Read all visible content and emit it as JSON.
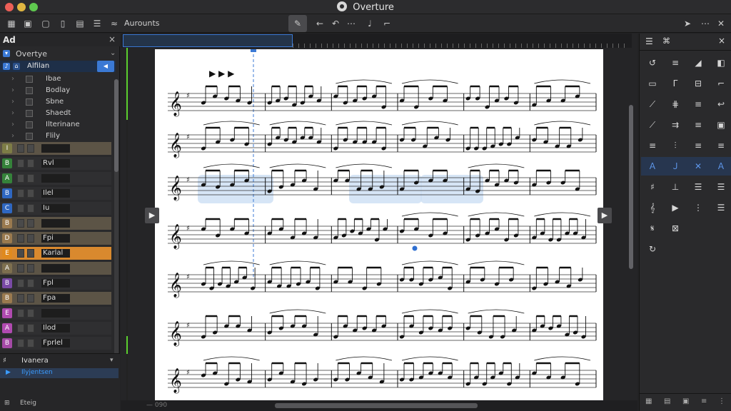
{
  "window": {
    "title": "Overture"
  },
  "toolbar": {
    "label": "Aurounts"
  },
  "left_panel": {
    "header": "Ad",
    "close_symbol": "×",
    "tree_root": "Overtye",
    "selected_item": "Alfilan",
    "tree_items": [
      "Ibae",
      "Bodlay",
      "Sbne",
      "Shaedt",
      "Ilterinane",
      "Flily"
    ],
    "tracks": [
      {
        "badge": "I",
        "color": "#7d7c46",
        "name": "",
        "extra": ""
      },
      {
        "badge": "B",
        "color": "#35823a",
        "name": "Rvl",
        "extra": ""
      },
      {
        "badge": "A",
        "color": "#35823a",
        "name": "",
        "extra": ""
      },
      {
        "badge": "B",
        "color": "#2f67c1",
        "name": "Ilel",
        "extra": ""
      },
      {
        "badge": "C",
        "color": "#2f67c1",
        "name": "Iu",
        "extra": ""
      },
      {
        "badge": "B",
        "color": "#9a7a4f",
        "name": "",
        "extra": ""
      },
      {
        "badge": "D",
        "color": "#9a7a4f",
        "name": "Fpi",
        "extra": ""
      },
      {
        "badge": "E",
        "color": "#e08a1e",
        "name": "Karlal",
        "extra": ""
      },
      {
        "badge": "A",
        "color": "#7d6f4f",
        "name": "",
        "extra": ""
      },
      {
        "badge": "B",
        "color": "#7a4aa6",
        "name": "Fpl",
        "extra": ""
      },
      {
        "badge": "B",
        "color": "#9a7a4f",
        "name": "Fpa",
        "extra": ""
      },
      {
        "badge": "E",
        "color": "#b04ab0",
        "name": "",
        "extra": ""
      },
      {
        "badge": "A",
        "color": "#b04ab0",
        "name": "Ilod",
        "extra": ""
      },
      {
        "badge": "B",
        "color": "#a54aa6",
        "name": "Fprlel",
        "extra": ""
      }
    ],
    "bottom_header": "Ivanera",
    "bottom_item": "Ilyjentsen",
    "footer_label": "Eteig"
  },
  "score": {
    "zoom_text": "— 090",
    "tempo_marks": "▶ ▶ ▶"
  },
  "right_panel": {
    "close_symbol": "×",
    "tab_symbol": "⌘"
  }
}
